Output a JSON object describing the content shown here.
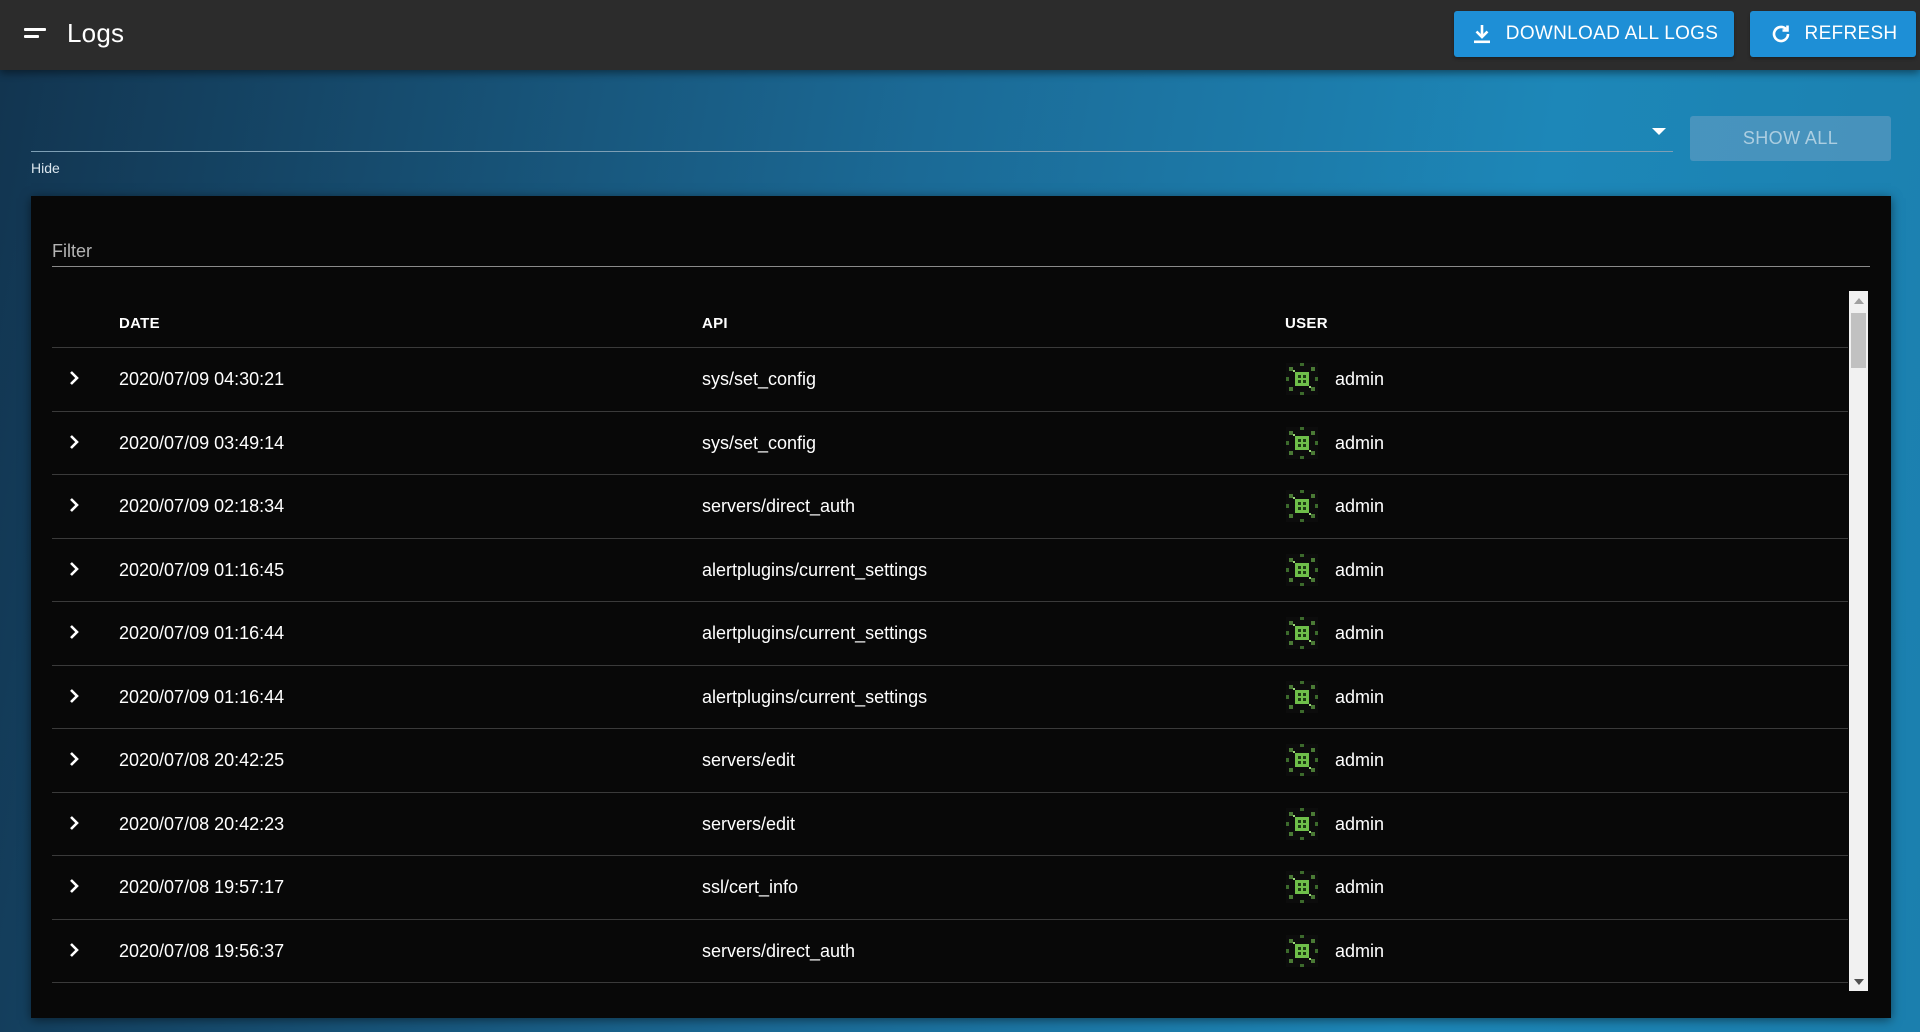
{
  "header": {
    "title": "Logs",
    "menu_icon": "menu-icon",
    "download_label": "DOWNLOAD ALL LOGS",
    "download_icon": "download-icon",
    "refresh_label": "REFRESH",
    "refresh_icon": "refresh-icon"
  },
  "hide_select": {
    "label": "Hide",
    "value": "",
    "show_all_label": "SHOW ALL"
  },
  "filter": {
    "placeholder": "Filter",
    "value": ""
  },
  "table": {
    "columns": [
      "DATE",
      "API",
      "USER"
    ],
    "rows": [
      {
        "date": "2020/07/09 04:30:21",
        "api": "sys/set_config",
        "user": "admin"
      },
      {
        "date": "2020/07/09 03:49:14",
        "api": "sys/set_config",
        "user": "admin"
      },
      {
        "date": "2020/07/09 02:18:34",
        "api": "servers/direct_auth",
        "user": "admin"
      },
      {
        "date": "2020/07/09 01:16:45",
        "api": "alertplugins/current_settings",
        "user": "admin"
      },
      {
        "date": "2020/07/09 01:16:44",
        "api": "alertplugins/current_settings",
        "user": "admin"
      },
      {
        "date": "2020/07/09 01:16:44",
        "api": "alertplugins/current_settings",
        "user": "admin"
      },
      {
        "date": "2020/07/08 20:42:25",
        "api": "servers/edit",
        "user": "admin"
      },
      {
        "date": "2020/07/08 20:42:23",
        "api": "servers/edit",
        "user": "admin"
      },
      {
        "date": "2020/07/08 19:57:17",
        "api": "ssl/cert_info",
        "user": "admin"
      },
      {
        "date": "2020/07/08 19:56:37",
        "api": "servers/direct_auth",
        "user": "admin"
      }
    ]
  },
  "colors": {
    "accent": "#1e8fd6",
    "topbar": "#2c2c2c",
    "card": "#080808",
    "avatar_green": "#6fbf4a"
  }
}
